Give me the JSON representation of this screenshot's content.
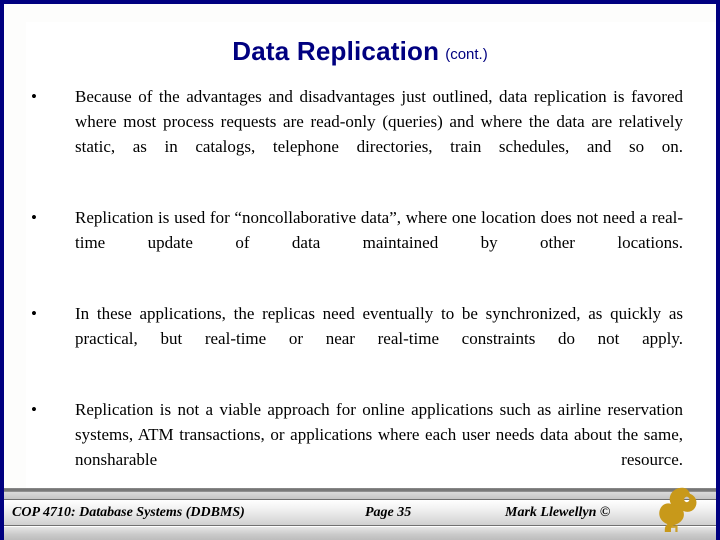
{
  "slide": {
    "title_main": "Data Replication",
    "title_sub": "(cont.)",
    "title_color": "#000080",
    "border_color": "#000080",
    "background_color": "#ffffff",
    "body_text_color": "#000000"
  },
  "bullets": [
    {
      "marker": "•",
      "text": "Because of the advantages and disadvantages just outlined, data replication is favored where most process requests are read-only (queries) and where the data are relatively static, as in catalogs, telephone directories, train schedules, and so on."
    },
    {
      "marker": "•",
      "text": "Replication is used for “noncollaborative data”, where one location does not need a real-time update of data maintained by other locations."
    },
    {
      "marker": "•",
      "text": "In these applications, the replicas need eventually to be synchronized, as quickly as practical, but real-time or near real-time constraints do not apply."
    },
    {
      "marker": "•",
      "text": "Replication is not a viable approach for online applications such as airline reservation systems, ATM transactions, or applications where each user needs data about the same, nonsharable resource."
    }
  ],
  "footer": {
    "course": "COP 4710: Database Systems  (DDBMS)",
    "page": "Page 35",
    "author": "Mark Llewellyn ©",
    "logo_name": "ucf-pegasus-logo",
    "logo_color": "#C8991A"
  }
}
